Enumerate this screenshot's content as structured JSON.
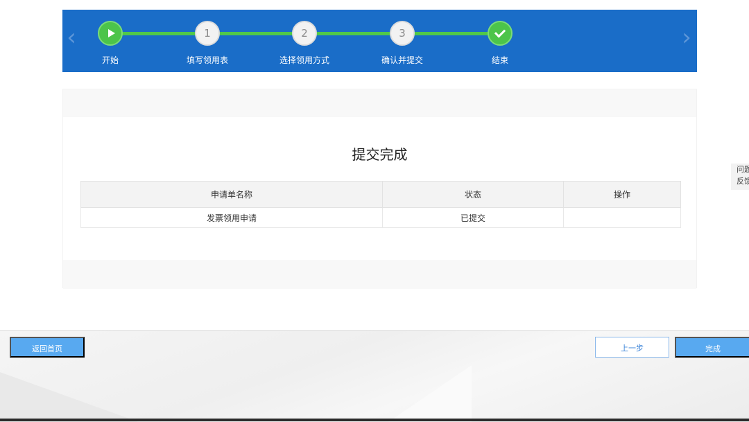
{
  "stepper": {
    "steps": [
      {
        "label": "开始",
        "marker": "",
        "icon": "play-icon",
        "state": "done"
      },
      {
        "label": "填写领用表",
        "marker": "1",
        "state": "done"
      },
      {
        "label": "选择领用方式",
        "marker": "2",
        "state": "done"
      },
      {
        "label": "确认并提交",
        "marker": "3",
        "state": "done"
      },
      {
        "label": "结束",
        "marker": "",
        "icon": "check-icon",
        "state": "current"
      }
    ]
  },
  "result": {
    "title": "提交完成",
    "table": {
      "headers": [
        "申请单名称",
        "状态",
        "操作"
      ],
      "rows": [
        [
          "发票领用申请",
          "已提交",
          ""
        ]
      ]
    }
  },
  "feedback": {
    "line1": "问题",
    "line2": "反馈"
  },
  "actions": {
    "home_label": "返回首页",
    "prev_label": "上一步",
    "finish_label": "完成"
  },
  "colors": {
    "banner": "#1a6dc8",
    "step_done": "#4cc44a",
    "button_primary": "#58a9f0"
  }
}
